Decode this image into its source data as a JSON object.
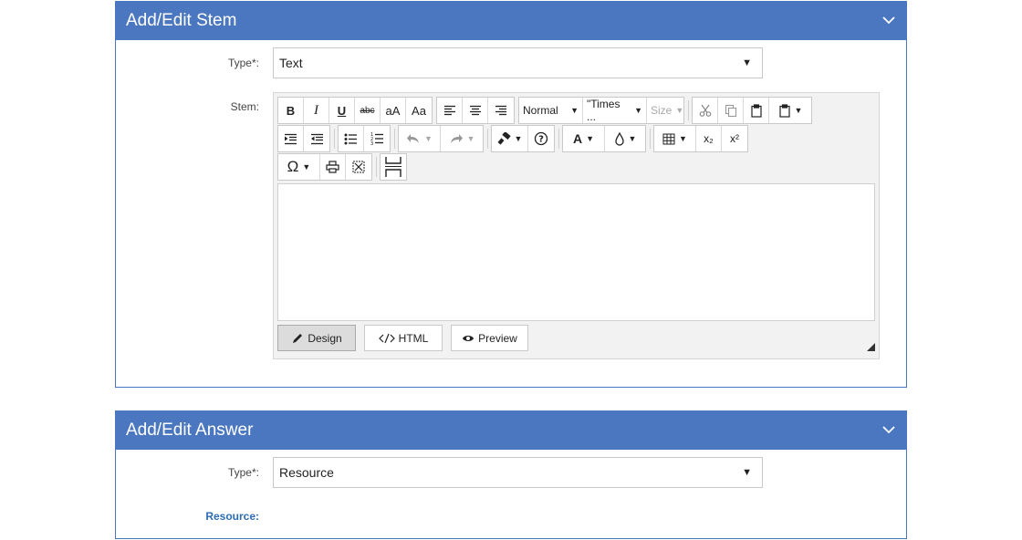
{
  "stem_panel": {
    "title": "Add/Edit Stem",
    "type_label": "Type*:",
    "type_value": "Text",
    "stem_label": "Stem:",
    "toolbar": {
      "bold": "B",
      "italic": "I",
      "underline": "U",
      "strike": "abc",
      "case_upper": "aA",
      "case_title": "Aa",
      "format_value": "Normal",
      "font_value": "\"Times ...",
      "size_value": "Size",
      "font_color": "A",
      "subscript": "x₂",
      "superscript": "x²",
      "special_char": "Ω"
    },
    "modes": {
      "design": "Design",
      "html": "HTML",
      "preview": "Preview"
    }
  },
  "answer_panel": {
    "title": "Add/Edit Answer",
    "type_label": "Type*:",
    "type_value": "Resource",
    "resource_label": "Resource:"
  },
  "colors": {
    "header": "#4a77bf",
    "link": "#2c6db5"
  }
}
